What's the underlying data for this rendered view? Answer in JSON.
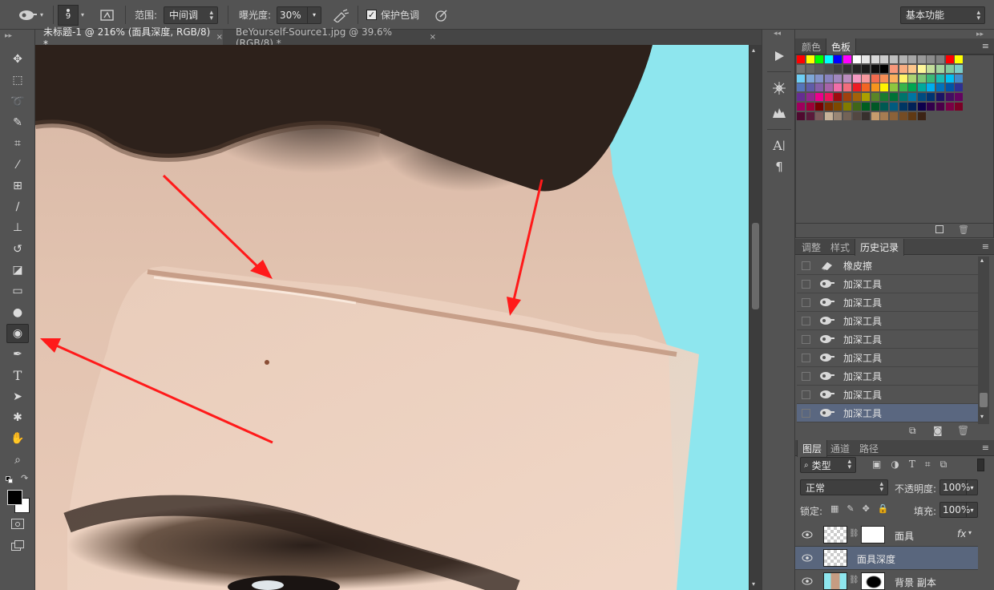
{
  "options_bar": {
    "brush_size": "9",
    "range_label": "范围:",
    "range_value": "中间调",
    "exposure_label": "曝光度:",
    "exposure_value": "30%",
    "protect_label": "保护色调",
    "protect_checked": true,
    "workspace": "基本功能"
  },
  "documents": [
    {
      "title": "未标题-1 @ 216% (面具深度, RGB/8) *",
      "close": "×",
      "active": true
    },
    {
      "title": "BeYourself-Source1.jpg @ 39.6%(RGB/8) *",
      "close": "×",
      "active": false
    }
  ],
  "tools": [
    "move-tool-icon",
    "marquee-tool-icon",
    "lasso-tool-icon",
    "quick-select-tool-icon",
    "crop-tool-icon",
    "eyedropper-tool-icon",
    "healing-brush-tool-icon",
    "brush-tool-icon",
    "clone-stamp-tool-icon",
    "history-brush-tool-icon",
    "eraser-tool-icon",
    "gradient-tool-icon",
    "blur-tool-icon",
    "burn-tool-icon",
    "pen-tool-icon",
    "type-tool-icon",
    "path-select-tool-icon",
    "custom-shape-tool-icon",
    "hand-tool-icon",
    "zoom-tool-icon"
  ],
  "type_tool_glyph": "T",
  "swatch_panel": {
    "tabs": [
      "颜色",
      "色板"
    ],
    "active_tab": "色板",
    "rows": [
      [
        "#ff0000",
        "#ffff00",
        "#00ff00",
        "#00ffff",
        "#0000ff",
        "#ff00ff",
        "#ffffff",
        "#e6e6e6",
        "#d9d9d9",
        "#cccccc",
        "#bfbfbf",
        "#b3b3b3",
        "#a6a6a6",
        "#999999",
        "#8c8c8c",
        "#808080",
        "#ff0000",
        "#ffff00"
      ],
      [
        "#737373",
        "#666666",
        "#595959",
        "#4d4d4d",
        "#404040",
        "#333333",
        "#262626",
        "#1a1a1a",
        "#0d0d0d",
        "#000000",
        "#f7977a",
        "#f9ad81",
        "#fdc68a",
        "#fff79a",
        "#c4df9b",
        "#a3d39c",
        "#82ca9d",
        "#7bcdc8"
      ],
      [
        "#6ecff6",
        "#7ea7d8",
        "#8493ca",
        "#8882be",
        "#a187be",
        "#bc8dbf",
        "#f49ac2",
        "#f6989d",
        "#f26c4f",
        "#f68e55",
        "#fbaf5c",
        "#fff467",
        "#acd372",
        "#7cc576",
        "#3bb878",
        "#1abbb4",
        "#00bff3",
        "#438ccb"
      ],
      [
        "#5574b9",
        "#605ca8",
        "#855fa8",
        "#a763a8",
        "#f06ea9",
        "#f26d7d",
        "#ed1c24",
        "#f26522",
        "#f7941d",
        "#fff200",
        "#8dc63f",
        "#39b54a",
        "#00a651",
        "#00a99d",
        "#00aeef",
        "#0072bc",
        "#0054a6",
        "#2e3192"
      ],
      [
        "#662d91",
        "#92278f",
        "#ec008c",
        "#ed145b",
        "#9e0b0f",
        "#a0410d",
        "#a3620a",
        "#aba000",
        "#598527",
        "#1a7b30",
        "#007236",
        "#00746b",
        "#0076a3",
        "#004b80",
        "#003471",
        "#1b1464",
        "#440e62",
        "#630460"
      ],
      [
        "#9e005d",
        "#9e0039",
        "#790000",
        "#7b2e00",
        "#7d4900",
        "#827b00",
        "#406618",
        "#005e20",
        "#005826",
        "#005952",
        "#005b7f",
        "#003663",
        "#002157",
        "#0d004c",
        "#32004b",
        "#4b0049",
        "#7b0046",
        "#7a0026"
      ],
      [
        "#4f0a2f",
        "#5a1a3a",
        "#7a5a5a",
        "#c7b299",
        "#998675",
        "#736357",
        "#534741",
        "#37302d",
        "#c69c6d",
        "#a67c52",
        "#8c6239",
        "#754c24",
        "#603913",
        "#3c2415"
      ]
    ]
  },
  "history_panel": {
    "tabs": [
      "调整",
      "样式",
      "历史记录"
    ],
    "active_tab": "历史记录",
    "items": [
      {
        "label": "橡皮擦",
        "icon": "eraser-icon"
      },
      {
        "label": "加深工具",
        "icon": "burn-icon"
      },
      {
        "label": "加深工具",
        "icon": "burn-icon"
      },
      {
        "label": "加深工具",
        "icon": "burn-icon"
      },
      {
        "label": "加深工具",
        "icon": "burn-icon"
      },
      {
        "label": "加深工具",
        "icon": "burn-icon"
      },
      {
        "label": "加深工具",
        "icon": "burn-icon"
      },
      {
        "label": "加深工具",
        "icon": "burn-icon"
      },
      {
        "label": "加深工具",
        "icon": "burn-icon",
        "selected": true
      }
    ]
  },
  "layers_panel": {
    "tabs": [
      "图层",
      "通道",
      "路径"
    ],
    "active_tab": "图层",
    "filter_label": "类型",
    "blend_mode": "正常",
    "opacity_label": "不透明度:",
    "opacity_value": "100%",
    "lock_label": "锁定:",
    "fill_label": "填充:",
    "fill_value": "100%",
    "layers": [
      {
        "name": "面具",
        "fx": "fx"
      },
      {
        "name": "面具深度",
        "selected": true
      },
      {
        "name": "背景 副本"
      }
    ]
  },
  "dock_text": {
    "char": "A",
    "para": "¶"
  },
  "colors": {
    "canvas_bg": "#8ee6ee",
    "arrow": "#ff1a1a",
    "selection": "#5a6780"
  }
}
